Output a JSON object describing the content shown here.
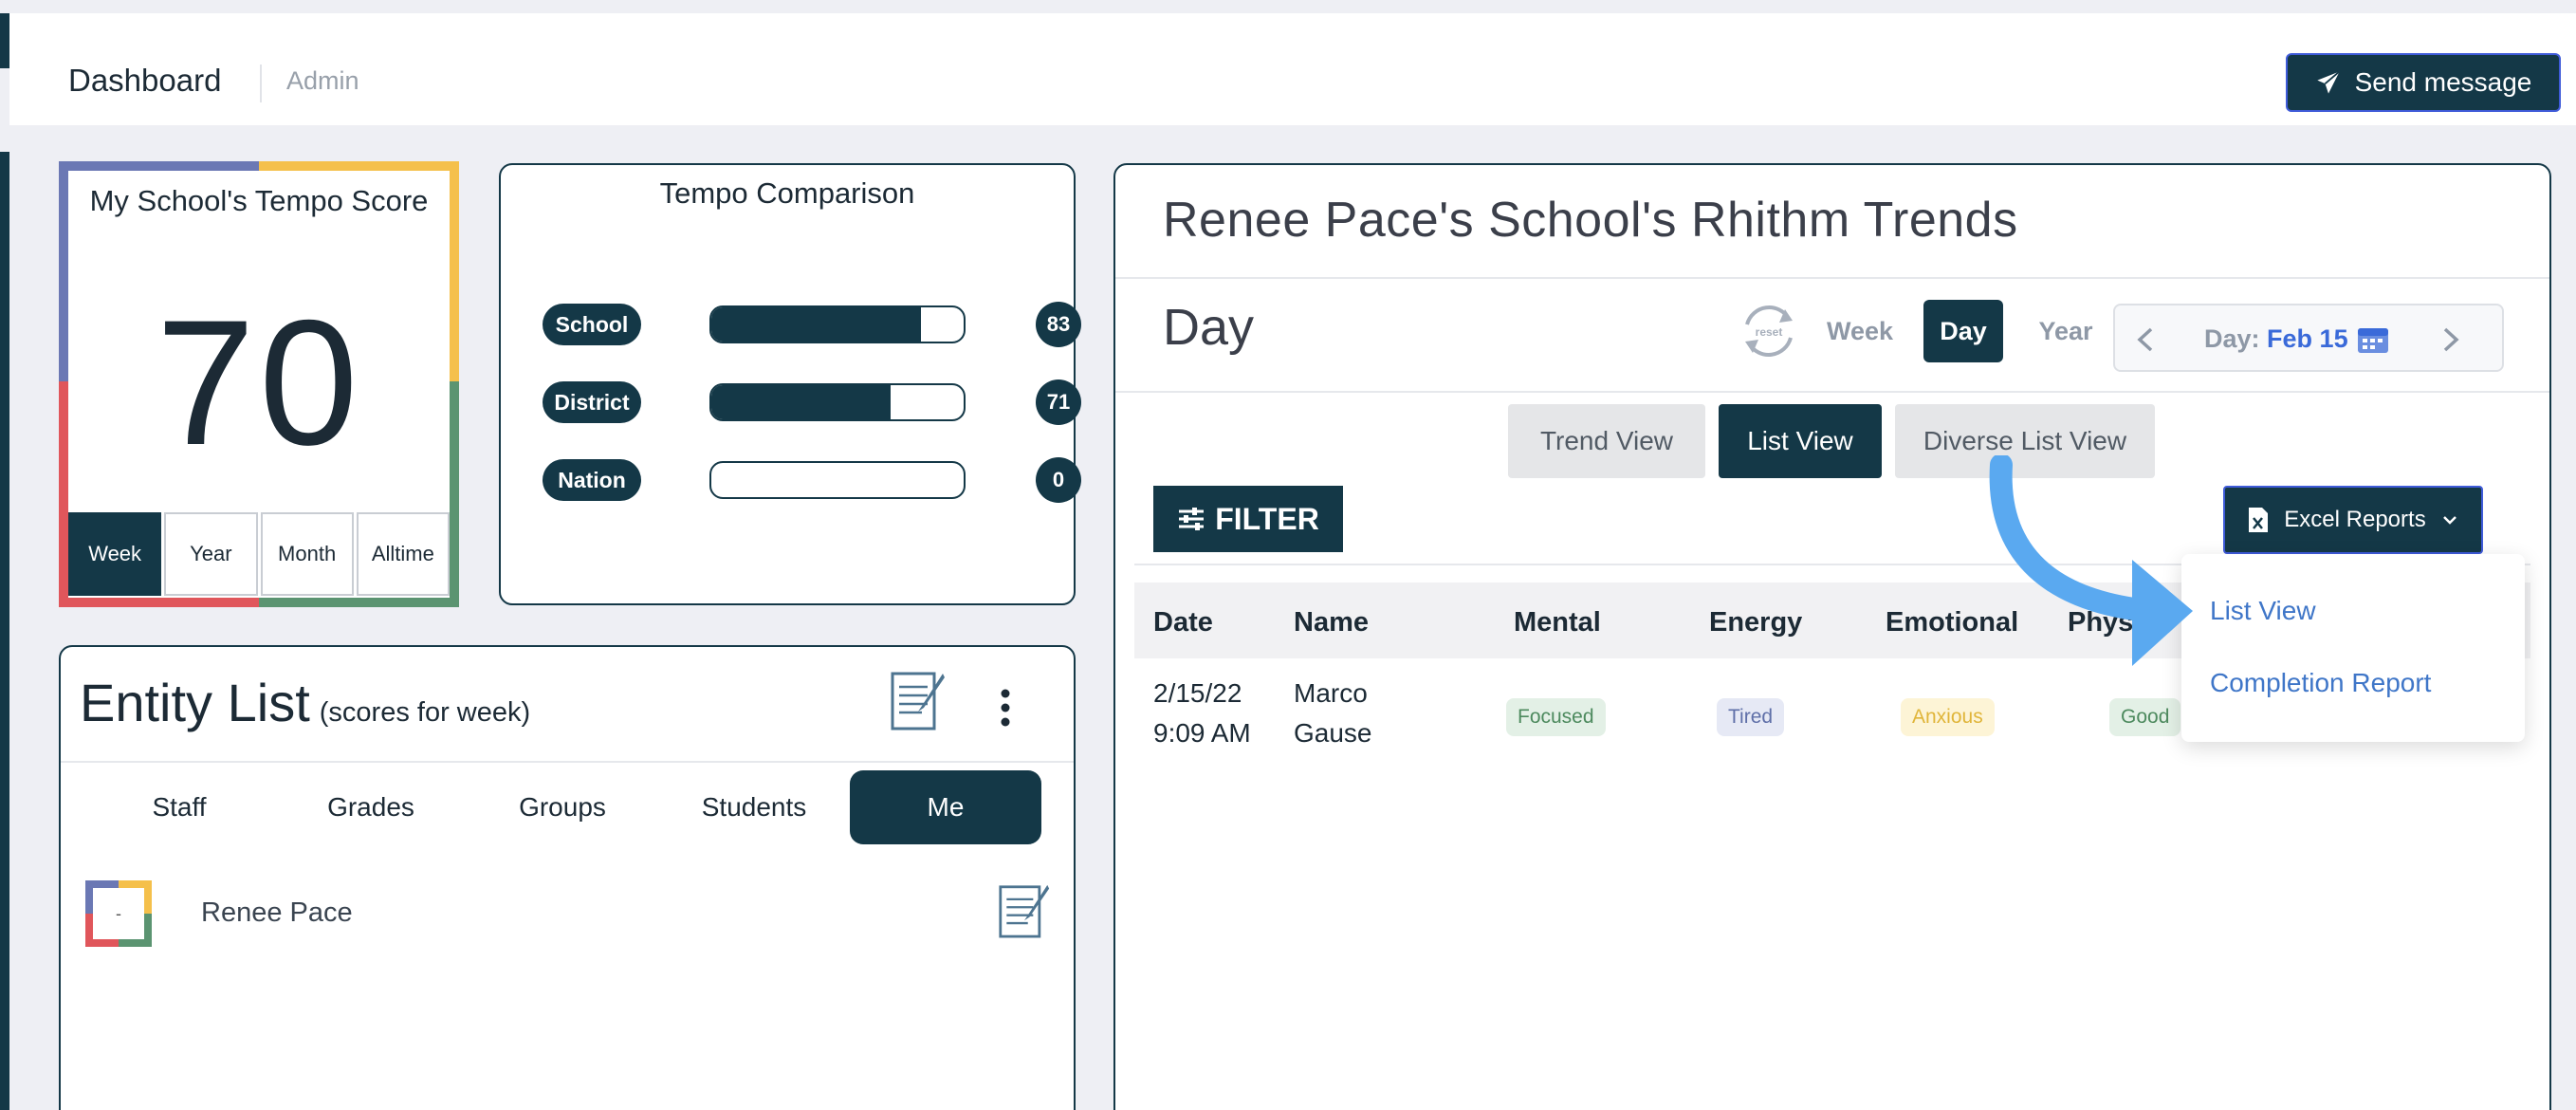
{
  "header": {
    "title": "Dashboard",
    "subtitle": "Admin",
    "send_button": "Send message"
  },
  "score_card": {
    "title": "My School's Tempo Score",
    "value": "70",
    "tabs": [
      "Week",
      "Year",
      "Month",
      "Alltime"
    ],
    "active_tab": "Week"
  },
  "comparison": {
    "title": "Tempo Comparison",
    "rows": [
      {
        "label": "School",
        "value": "83",
        "fill": 0.83
      },
      {
        "label": "District",
        "value": "71",
        "fill": 0.71
      },
      {
        "label": "Nation",
        "value": "0",
        "fill": 0
      }
    ]
  },
  "entity": {
    "title": "Entity List",
    "subtitle": "(scores for week)",
    "tabs": [
      "Staff",
      "Grades",
      "Groups",
      "Students",
      "Me"
    ],
    "active_tab": "Me",
    "items": [
      {
        "avatar_text": "-",
        "name": "Renee Pace"
      }
    ]
  },
  "trends": {
    "title": "Renee Pace's School's Rhithm Trends",
    "period_label": "Day",
    "reset_label": "reset",
    "period_tabs": [
      "Week",
      "Day",
      "Year"
    ],
    "active_period": "Day",
    "date_prefix": "Day:",
    "date_value": "Feb 15",
    "view_tabs": [
      "Trend View",
      "List View",
      "Diverse List View"
    ],
    "active_view": "List View",
    "filter_label": "FILTER",
    "excel_label": "Excel Reports",
    "columns": [
      "Date",
      "Name",
      "Mental",
      "Energy",
      "Emotional",
      "Phys"
    ],
    "rows": [
      {
        "date_line1": "2/15/22",
        "date_line2": "9:09 AM",
        "name_line1": "Marco",
        "name_line2": "Gause",
        "mental": "Focused",
        "energy": "Tired",
        "emotional": "Anxious",
        "physical": "Good"
      }
    ],
    "dropdown": [
      "List View",
      "Completion Report"
    ]
  },
  "colors": {
    "navy": "#143847",
    "blue_frame": "#6b78b4",
    "yellow_frame": "#f5c04b",
    "red_frame": "#e0565b",
    "green_frame": "#5b9471",
    "link": "#3f76c8",
    "arrow": "#5aa9f0"
  }
}
